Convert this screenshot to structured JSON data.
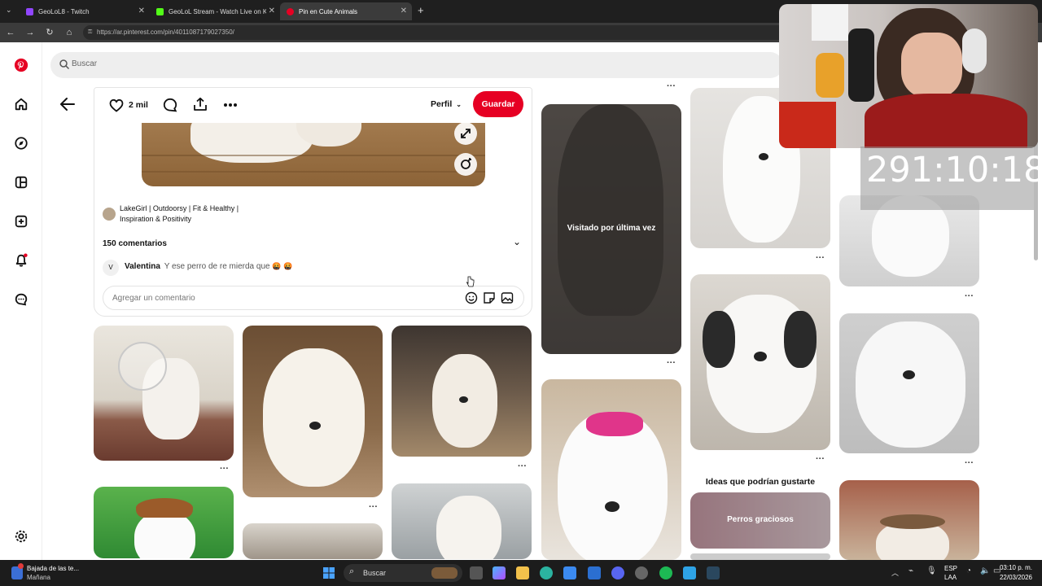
{
  "browser": {
    "tabs": [
      {
        "title": "GeoLoL8 - Twitch",
        "color": "#9146ff"
      },
      {
        "title": "GeoLoL Stream - Watch Live on Ki",
        "color": "#53fc18"
      },
      {
        "title": "Pin en Cute Animals",
        "color": "#e60023"
      }
    ],
    "url": "https://ar.pinterest.com/pin/4011087179027350/"
  },
  "search": {
    "placeholder": "Buscar"
  },
  "pin": {
    "likes": "2 mil",
    "profile_label": "Perfil",
    "save_label": "Guardar",
    "author": "LakeGirl | Outdoorsy | Fit & Healthy |",
    "author_line2": "Inspiration & Positivity",
    "comments_title": "150 comentarios",
    "comment": {
      "initial": "V",
      "user": "Valentina",
      "text": "Y ese perro de re mierda que",
      "emoji": "🤬 🤬"
    },
    "comment_placeholder": "Agregar un comentario"
  },
  "grid": {
    "visited_label": "Visitado por última vez",
    "section_title": "Ideas que podrían gustarte",
    "idea_board": "Perros graciosos"
  },
  "stream": {
    "timer": "291:10:18"
  },
  "taskbar": {
    "notification_title": "Bajada de las te...",
    "notification_sub": "Mañana",
    "search_label": "Buscar",
    "lang": "ESP",
    "lang_sub": "LAA",
    "time": "03:10 p. m.",
    "date": "22/03/2026"
  },
  "colors": {
    "brand": "#e60023"
  }
}
